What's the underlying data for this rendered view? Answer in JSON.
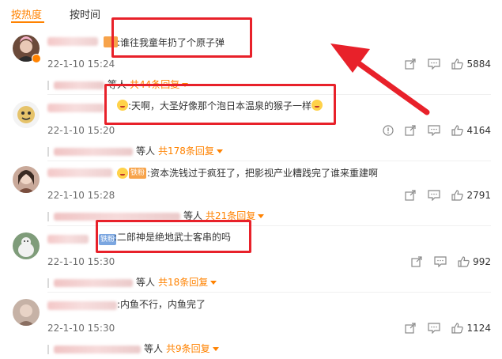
{
  "tabs": {
    "hot": "按热度",
    "time": "按时间"
  },
  "comments": [
    {
      "tag_color": "#f7a34a",
      "content": ":谁往我童年扔了个原子弹",
      "time": "22-1-10 15:24",
      "likes": "5884",
      "reply_suffix": "等人",
      "reply_link": "共44条回复"
    },
    {
      "content": ":天啊，大圣好像那个泡日本温泉的猴子一样",
      "time": "22-1-10 15:20",
      "likes": "4164",
      "reply_suffix": "等人",
      "reply_link": "共178条回复"
    },
    {
      "tag_text": "铁粉",
      "tag_color": "#f7a34a",
      "content": ":资本洗钱过于疯狂了，把影视产业糟践完了谁来重建啊",
      "time": "22-1-10 15:28",
      "likes": "2791",
      "reply_suffix": "等人",
      "reply_link": "共21条回复"
    },
    {
      "tag_text": "铁粉",
      "tag_color": "#7ba6e0",
      "content": ":二郎神是绝地武士客串的吗",
      "time": "22-1-10 15:30",
      "likes": "992",
      "reply_suffix": "等人",
      "reply_link": "共18条回复"
    },
    {
      "content": ":内鱼不行，内鱼完了",
      "time": "22-1-10 15:30",
      "likes": "1124",
      "reply_suffix": "等人",
      "reply_link": "共9条回复"
    }
  ],
  "colors": {
    "accent": "#ff8200",
    "highlight": "#e8212a"
  },
  "icons": [
    "share-icon",
    "comment-icon",
    "like-icon",
    "report-icon",
    "caret-down-icon"
  ]
}
